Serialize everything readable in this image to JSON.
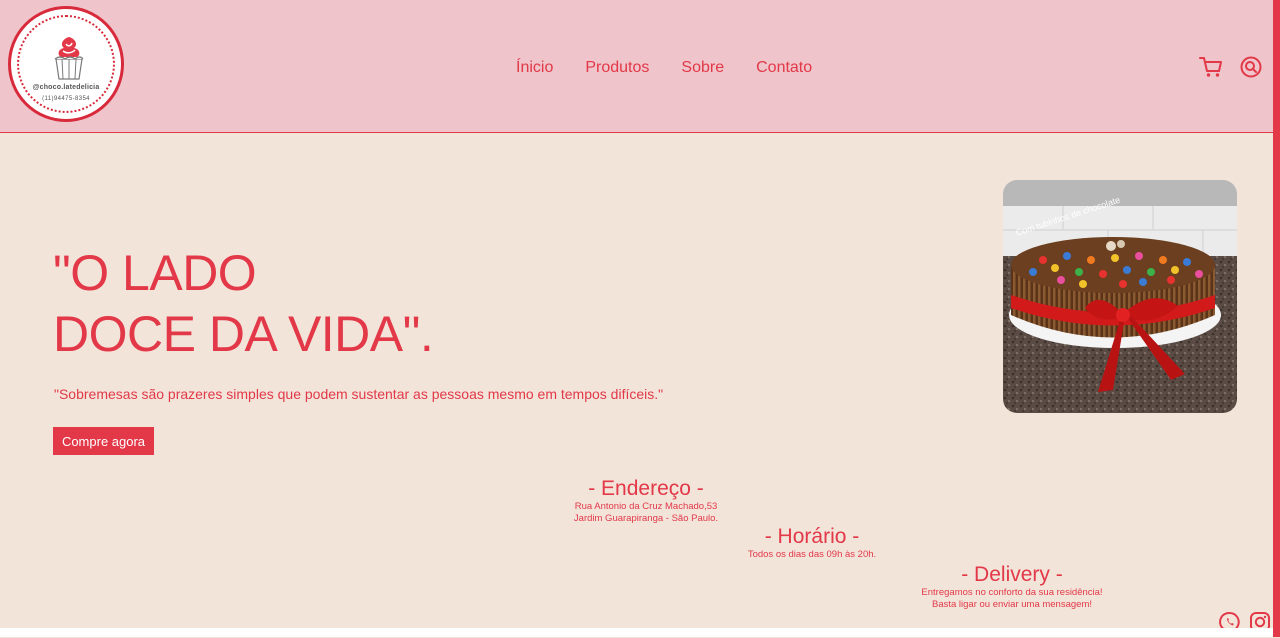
{
  "brand": {
    "handle": "@choco.latedelicia",
    "phone": "(11)94475-8354"
  },
  "nav": {
    "items": [
      "Ínicio",
      "Produtos",
      "Sobre",
      "Contato"
    ]
  },
  "icons": {
    "cart": "cart-icon",
    "search": "search-icon",
    "whatsapp": "whatsapp-icon",
    "instagram": "instagram-icon"
  },
  "hero": {
    "title_line1": "\"O LADO",
    "title_line2": "DOCE DA VIDA\".",
    "quote": "\"Sobremesas são prazeres simples que podem sustentar as pessoas mesmo em tempos difíceis.\"",
    "cta_label": "Compre agora",
    "image_caption": "Com tubinhos de chocolate"
  },
  "info": {
    "address": {
      "title": "- Endereço -",
      "line1": "Rua Antonio da Cruz Machado,53",
      "line2": "Jardim Guarapiranga - São Paulo."
    },
    "hours": {
      "title": "- Horário -",
      "line1": "Todos os dias das 09h às 20h."
    },
    "delivery": {
      "title": "- Delivery -",
      "line1": "Entregamos no conforto da sua residência!",
      "line2": "Basta ligar ou enviar uma mensagem!"
    }
  },
  "colors": {
    "accent": "#e23848",
    "header_bg": "#efc4ca",
    "page_bg": "#f3e4da"
  }
}
